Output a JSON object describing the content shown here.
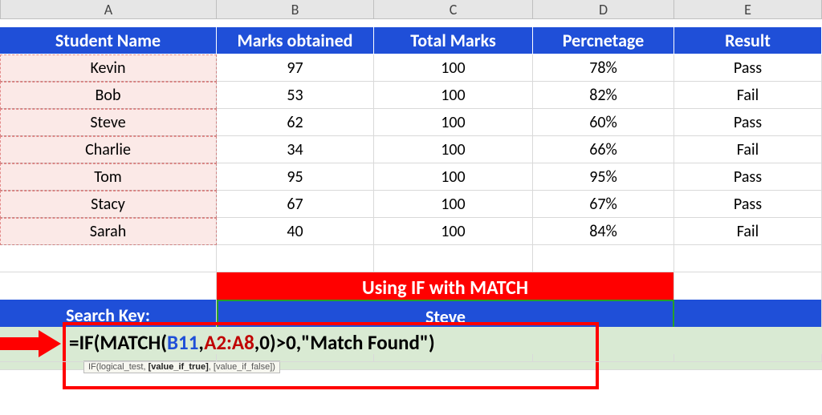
{
  "columns": [
    "A",
    "B",
    "C",
    "D",
    "E"
  ],
  "headers": {
    "A": "Student Name",
    "B": "Marks obtained",
    "C": "Total Marks",
    "D": "Percnetage",
    "E": "Result"
  },
  "rows": [
    {
      "name": "Kevin",
      "marks": "97",
      "total": "100",
      "pct": "78%",
      "res": "Pass"
    },
    {
      "name": "Bob",
      "marks": "53",
      "total": "100",
      "pct": "82%",
      "res": "Fail"
    },
    {
      "name": "Steve",
      "marks": "62",
      "total": "100",
      "pct": "60%",
      "res": "Pass"
    },
    {
      "name": "Charlie",
      "marks": "34",
      "total": "100",
      "pct": "66%",
      "res": "Fail"
    },
    {
      "name": "Tom",
      "marks": "95",
      "total": "100",
      "pct": "95%",
      "res": "Pass"
    },
    {
      "name": "Stacy",
      "marks": "67",
      "total": "100",
      "pct": "67%",
      "res": "Pass"
    },
    {
      "name": "Sarah",
      "marks": "40",
      "total": "100",
      "pct": "84%",
      "res": "Fail"
    }
  ],
  "sectionTitle": "Using IF with MATCH",
  "searchLabel": "Search Key:",
  "searchValue": "Steve",
  "formula": {
    "prefix": "=IF(MATCH(",
    "ref1": "B11",
    "sep1": ",",
    "ref2": "A2:A8",
    "suffix": ",0)>0,\"Match Found\")"
  },
  "tooltip": {
    "fn": "IF(logical_test, ",
    "bold1": "[value_if_true]",
    "rest": ", [value_if_false])"
  }
}
